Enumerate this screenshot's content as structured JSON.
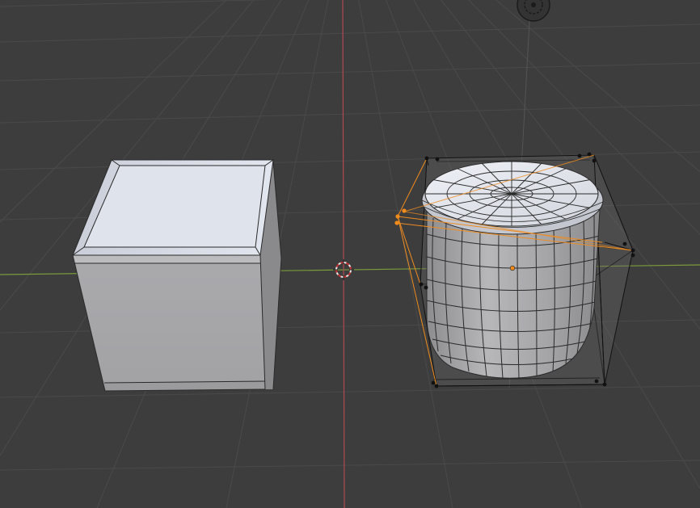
{
  "viewport": {
    "name": "3D Viewport",
    "grid": true,
    "axes": [
      "x-axis",
      "y-axis"
    ]
  },
  "colors": {
    "background": "#3d3d3d",
    "grid_line": "#4a4a4a",
    "x_axis": "#7a9a3c",
    "y_axis": "#b04a50",
    "object_light": "#d7dce6",
    "object_mid": "#a8a8ab",
    "object_dark": "#8a8a8d",
    "wire": "#2a2a2a",
    "selection": "#f08c1e",
    "lattice": "#111111"
  },
  "objects": [
    {
      "name": "beveled-cube",
      "selected": false
    },
    {
      "name": "cylinder-with-lattice-deformer",
      "selected": true
    }
  ],
  "gizmos": [
    "3d-cursor-icon",
    "object-origin-icon",
    "camera-target-icon"
  ]
}
